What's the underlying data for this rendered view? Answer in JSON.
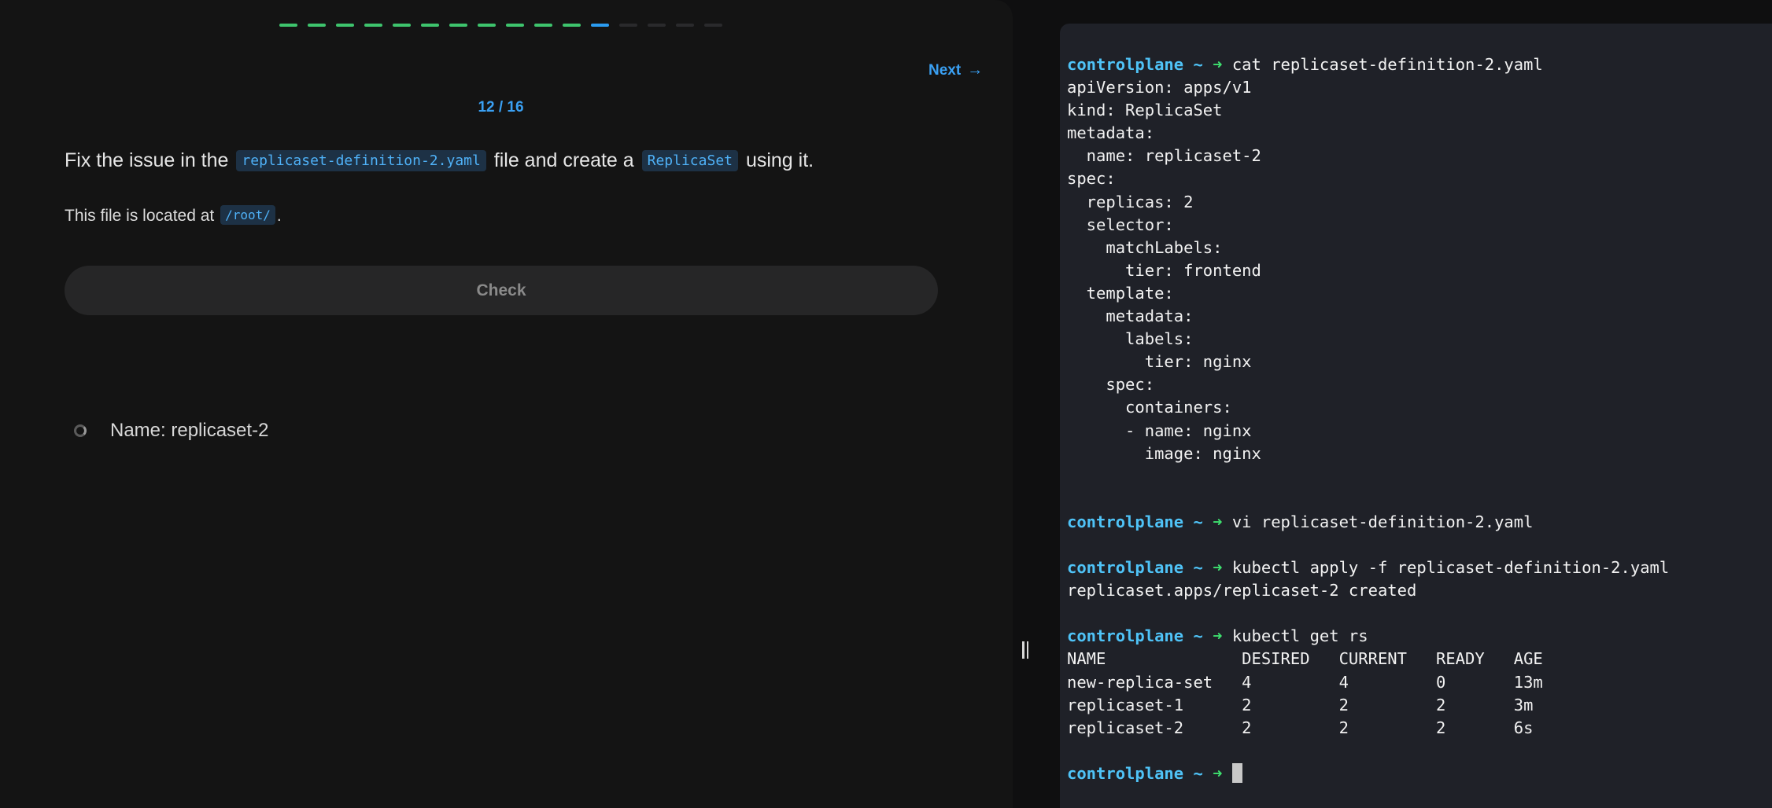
{
  "quiz": {
    "progress": {
      "completed": 11,
      "current": 12,
      "total": 16
    },
    "next_label": "Next",
    "next_icon": "arrow-right-icon",
    "counter": "12 / 16",
    "question": {
      "part1": "Fix the issue in the ",
      "code1": "replicaset-definition-2.yaml",
      "part2": " file and create a ",
      "code2": "ReplicaSet",
      "part3": " using it."
    },
    "location": {
      "prefix": "This file is located at ",
      "path": "/root/",
      "suffix": "."
    },
    "check_label": "Check",
    "tasks": [
      {
        "label": "Name: replicaset-2",
        "status_icon": "pending-circle-icon"
      }
    ]
  },
  "terminal": {
    "prompt": {
      "host": "controlplane",
      "tilde": "~",
      "arrow": "➜"
    },
    "lines": [
      {
        "type": "cmd",
        "text": "cat replicaset-definition-2.yaml"
      },
      {
        "type": "out",
        "text": "apiVersion: apps/v1"
      },
      {
        "type": "out",
        "text": "kind: ReplicaSet"
      },
      {
        "type": "out",
        "text": "metadata:"
      },
      {
        "type": "out",
        "text": "  name: replicaset-2"
      },
      {
        "type": "out",
        "text": "spec:"
      },
      {
        "type": "out",
        "text": "  replicas: 2"
      },
      {
        "type": "out",
        "text": "  selector:"
      },
      {
        "type": "out",
        "text": "    matchLabels:"
      },
      {
        "type": "out",
        "text": "      tier: frontend"
      },
      {
        "type": "out",
        "text": "  template:"
      },
      {
        "type": "out",
        "text": "    metadata:"
      },
      {
        "type": "out",
        "text": "      labels:"
      },
      {
        "type": "out",
        "text": "        tier: nginx"
      },
      {
        "type": "out",
        "text": "    spec:"
      },
      {
        "type": "out",
        "text": "      containers:"
      },
      {
        "type": "out",
        "text": "      - name: nginx"
      },
      {
        "type": "out",
        "text": "        image: nginx"
      },
      {
        "type": "out",
        "text": ""
      },
      {
        "type": "out",
        "text": ""
      },
      {
        "type": "cmd",
        "text": "vi replicaset-definition-2.yaml"
      },
      {
        "type": "out",
        "text": ""
      },
      {
        "type": "cmd",
        "text": "kubectl apply -f replicaset-definition-2.yaml"
      },
      {
        "type": "out",
        "text": "replicaset.apps/replicaset-2 created"
      },
      {
        "type": "out",
        "text": ""
      },
      {
        "type": "cmd",
        "text": "kubectl get rs"
      },
      {
        "type": "out",
        "text": "NAME              DESIRED   CURRENT   READY   AGE"
      },
      {
        "type": "out",
        "text": "new-replica-set   4         4         0       13m"
      },
      {
        "type": "out",
        "text": "replicaset-1      2         2         2       3m"
      },
      {
        "type": "out",
        "text": "replicaset-2      2         2         2       6s"
      },
      {
        "type": "out",
        "text": ""
      },
      {
        "type": "cmd",
        "text": "",
        "cursor": true
      }
    ]
  },
  "colors": {
    "progress_done": "#3ec46d",
    "progress_current": "#2b9cf1",
    "progress_todo": "#2a2a2c",
    "accent": "#3aa0f3",
    "prompt_host": "#4fc3f7",
    "prompt_arrow": "#3ee06f",
    "terminal_bg": "#1f2128"
  }
}
